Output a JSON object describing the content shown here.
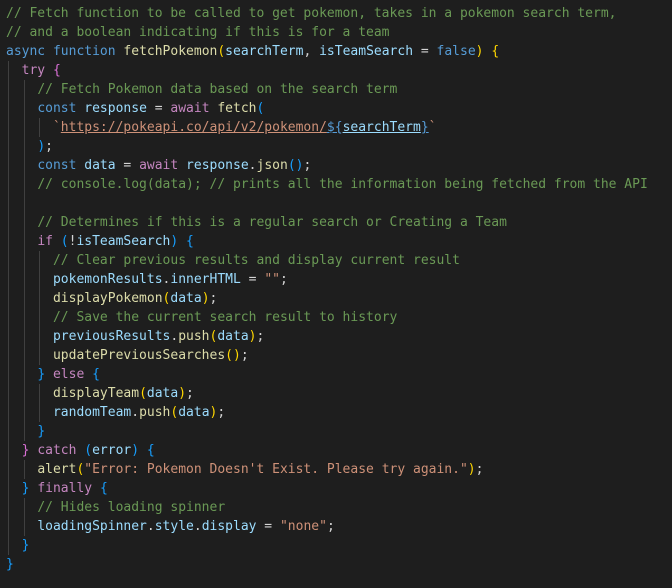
{
  "editor": {
    "language": "javascript",
    "theme_colors": {
      "background": "#1e1e1e",
      "comment": "#6a9955",
      "keyword": "#569cd6",
      "control": "#c586c0",
      "function": "#dcdcaa",
      "variable": "#9cdcfe",
      "string": "#ce9178",
      "punctuation": "#d4d4d4",
      "bracket_level_1": "#ffd700",
      "bracket_level_2": "#da70d6",
      "bracket_level_3": "#179fff"
    },
    "lines": [
      {
        "indent": 0,
        "tokens": [
          {
            "t": "// Fetch function to be called to get pokemon, takes in a pokemon search term,",
            "c": "comment"
          }
        ]
      },
      {
        "indent": 0,
        "tokens": [
          {
            "t": "// and a boolean indicating if this is for a team",
            "c": "comment"
          }
        ]
      },
      {
        "indent": 0,
        "tokens": [
          {
            "t": "async",
            "c": "keyword"
          },
          {
            "t": " ",
            "c": "punct"
          },
          {
            "t": "function",
            "c": "keyword"
          },
          {
            "t": " ",
            "c": "punct"
          },
          {
            "t": "fetchPokemon",
            "c": "function"
          },
          {
            "t": "(",
            "c": "bracket1"
          },
          {
            "t": "searchTerm",
            "c": "variable"
          },
          {
            "t": ", ",
            "c": "punct"
          },
          {
            "t": "isTeamSearch",
            "c": "variable"
          },
          {
            "t": " = ",
            "c": "punct"
          },
          {
            "t": "false",
            "c": "keyword"
          },
          {
            "t": ")",
            "c": "bracket1"
          },
          {
            "t": " ",
            "c": "punct"
          },
          {
            "t": "{",
            "c": "bracket1"
          }
        ]
      },
      {
        "indent": 1,
        "tokens": [
          {
            "t": "try",
            "c": "control"
          },
          {
            "t": " ",
            "c": "punct"
          },
          {
            "t": "{",
            "c": "bracket2"
          }
        ]
      },
      {
        "indent": 2,
        "tokens": [
          {
            "t": "// Fetch Pokemon data based on the search term",
            "c": "comment"
          }
        ]
      },
      {
        "indent": 2,
        "tokens": [
          {
            "t": "const",
            "c": "keyword"
          },
          {
            "t": " ",
            "c": "punct"
          },
          {
            "t": "response",
            "c": "variable"
          },
          {
            "t": " = ",
            "c": "punct"
          },
          {
            "t": "await",
            "c": "control"
          },
          {
            "t": " ",
            "c": "punct"
          },
          {
            "t": "fetch",
            "c": "function"
          },
          {
            "t": "(",
            "c": "bracket3"
          }
        ]
      },
      {
        "indent": 3,
        "tokens": [
          {
            "t": "`",
            "c": "string"
          },
          {
            "t": "https://pokeapi.co/api/v2/pokemon/",
            "c": "string",
            "link": true
          },
          {
            "t": "${",
            "c": "keyword",
            "link": true
          },
          {
            "t": "searchTerm",
            "c": "variable",
            "link": true
          },
          {
            "t": "}",
            "c": "keyword",
            "link": true
          },
          {
            "t": "`",
            "c": "string"
          }
        ]
      },
      {
        "indent": 2,
        "tokens": [
          {
            "t": ")",
            "c": "bracket3"
          },
          {
            "t": ";",
            "c": "punct"
          }
        ]
      },
      {
        "indent": 2,
        "tokens": [
          {
            "t": "const",
            "c": "keyword"
          },
          {
            "t": " ",
            "c": "punct"
          },
          {
            "t": "data",
            "c": "variable"
          },
          {
            "t": " = ",
            "c": "punct"
          },
          {
            "t": "await",
            "c": "control"
          },
          {
            "t": " ",
            "c": "punct"
          },
          {
            "t": "response",
            "c": "variable"
          },
          {
            "t": ".",
            "c": "punct"
          },
          {
            "t": "json",
            "c": "function"
          },
          {
            "t": "()",
            "c": "bracket3"
          },
          {
            "t": ";",
            "c": "punct"
          }
        ]
      },
      {
        "indent": 2,
        "tokens": [
          {
            "t": "// console.log(data); // prints all the information being fetched from the API",
            "c": "comment"
          }
        ]
      },
      {
        "indent": 2,
        "tokens": []
      },
      {
        "indent": 2,
        "tokens": [
          {
            "t": "// Determines if this is a regular search or Creating a Team",
            "c": "comment"
          }
        ]
      },
      {
        "indent": 2,
        "tokens": [
          {
            "t": "if",
            "c": "control"
          },
          {
            "t": " ",
            "c": "punct"
          },
          {
            "t": "(",
            "c": "bracket3"
          },
          {
            "t": "!",
            "c": "punct"
          },
          {
            "t": "isTeamSearch",
            "c": "variable"
          },
          {
            "t": ")",
            "c": "bracket3"
          },
          {
            "t": " ",
            "c": "punct"
          },
          {
            "t": "{",
            "c": "bracket3"
          }
        ]
      },
      {
        "indent": 3,
        "tokens": [
          {
            "t": "// Clear previous results and display current result",
            "c": "comment"
          }
        ]
      },
      {
        "indent": 3,
        "tokens": [
          {
            "t": "pokemonResults",
            "c": "variable"
          },
          {
            "t": ".",
            "c": "punct"
          },
          {
            "t": "innerHTML",
            "c": "variable"
          },
          {
            "t": " = ",
            "c": "punct"
          },
          {
            "t": "\"\"",
            "c": "string"
          },
          {
            "t": ";",
            "c": "punct"
          }
        ]
      },
      {
        "indent": 3,
        "tokens": [
          {
            "t": "displayPokemon",
            "c": "function"
          },
          {
            "t": "(",
            "c": "bracket1"
          },
          {
            "t": "data",
            "c": "variable"
          },
          {
            "t": ")",
            "c": "bracket1"
          },
          {
            "t": ";",
            "c": "punct"
          }
        ]
      },
      {
        "indent": 3,
        "tokens": [
          {
            "t": "// Save the current search result to history",
            "c": "comment"
          }
        ]
      },
      {
        "indent": 3,
        "tokens": [
          {
            "t": "previousResults",
            "c": "variable"
          },
          {
            "t": ".",
            "c": "punct"
          },
          {
            "t": "push",
            "c": "function"
          },
          {
            "t": "(",
            "c": "bracket1"
          },
          {
            "t": "data",
            "c": "variable"
          },
          {
            "t": ")",
            "c": "bracket1"
          },
          {
            "t": ";",
            "c": "punct"
          }
        ]
      },
      {
        "indent": 3,
        "tokens": [
          {
            "t": "updatePreviousSearches",
            "c": "function"
          },
          {
            "t": "()",
            "c": "bracket1"
          },
          {
            "t": ";",
            "c": "punct"
          }
        ]
      },
      {
        "indent": 2,
        "tokens": [
          {
            "t": "}",
            "c": "bracket3"
          },
          {
            "t": " ",
            "c": "punct"
          },
          {
            "t": "else",
            "c": "control"
          },
          {
            "t": " ",
            "c": "punct"
          },
          {
            "t": "{",
            "c": "bracket3"
          }
        ]
      },
      {
        "indent": 3,
        "tokens": [
          {
            "t": "displayTeam",
            "c": "function"
          },
          {
            "t": "(",
            "c": "bracket1"
          },
          {
            "t": "data",
            "c": "variable"
          },
          {
            "t": ")",
            "c": "bracket1"
          },
          {
            "t": ";",
            "c": "punct"
          }
        ]
      },
      {
        "indent": 3,
        "tokens": [
          {
            "t": "randomTeam",
            "c": "variable"
          },
          {
            "t": ".",
            "c": "punct"
          },
          {
            "t": "push",
            "c": "function"
          },
          {
            "t": "(",
            "c": "bracket1"
          },
          {
            "t": "data",
            "c": "variable"
          },
          {
            "t": ")",
            "c": "bracket1"
          },
          {
            "t": ";",
            "c": "punct"
          }
        ]
      },
      {
        "indent": 2,
        "tokens": [
          {
            "t": "}",
            "c": "bracket3"
          }
        ]
      },
      {
        "indent": 1,
        "tokens": [
          {
            "t": "}",
            "c": "bracket2"
          },
          {
            "t": " ",
            "c": "punct"
          },
          {
            "t": "catch",
            "c": "control"
          },
          {
            "t": " ",
            "c": "punct"
          },
          {
            "t": "(",
            "c": "bracket3"
          },
          {
            "t": "error",
            "c": "variable"
          },
          {
            "t": ")",
            "c": "bracket3"
          },
          {
            "t": " ",
            "c": "punct"
          },
          {
            "t": "{",
            "c": "bracket3"
          }
        ]
      },
      {
        "indent": 2,
        "tokens": [
          {
            "t": "alert",
            "c": "function"
          },
          {
            "t": "(",
            "c": "bracket1"
          },
          {
            "t": "\"Error: Pokemon Doesn't Exist. Please try again.\"",
            "c": "string"
          },
          {
            "t": ")",
            "c": "bracket1"
          },
          {
            "t": ";",
            "c": "punct"
          }
        ]
      },
      {
        "indent": 1,
        "tokens": [
          {
            "t": "}",
            "c": "bracket3"
          },
          {
            "t": " ",
            "c": "punct"
          },
          {
            "t": "finally",
            "c": "control"
          },
          {
            "t": " ",
            "c": "punct"
          },
          {
            "t": "{",
            "c": "bracket3"
          }
        ]
      },
      {
        "indent": 2,
        "tokens": [
          {
            "t": "// Hides loading spinner",
            "c": "comment"
          }
        ]
      },
      {
        "indent": 2,
        "tokens": [
          {
            "t": "loadingSpinner",
            "c": "variable"
          },
          {
            "t": ".",
            "c": "punct"
          },
          {
            "t": "style",
            "c": "variable"
          },
          {
            "t": ".",
            "c": "punct"
          },
          {
            "t": "display",
            "c": "variable"
          },
          {
            "t": " = ",
            "c": "punct"
          },
          {
            "t": "\"none\"",
            "c": "string"
          },
          {
            "t": ";",
            "c": "punct"
          }
        ]
      },
      {
        "indent": 1,
        "tokens": [
          {
            "t": "}",
            "c": "bracket3"
          }
        ]
      },
      {
        "indent": 0,
        "tokens": [
          {
            "t": "}",
            "c": "bracket3"
          }
        ]
      }
    ]
  }
}
